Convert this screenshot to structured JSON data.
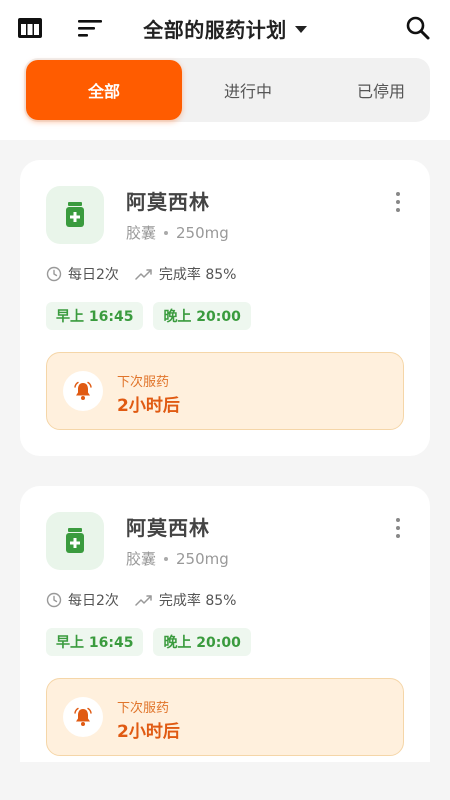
{
  "header": {
    "title": "全部的服药计划",
    "icons": [
      "table-view-icon",
      "sort-icon",
      "search-icon",
      "chevron-down-icon"
    ]
  },
  "tabs": [
    {
      "label": "全部",
      "active": true
    },
    {
      "label": "进行中",
      "active": false
    },
    {
      "label": "已停用",
      "active": false
    }
  ],
  "plans": [
    {
      "name": "阿莫西林",
      "form": "胶囊",
      "dose": "250mg",
      "frequency": "每日2次",
      "completion": "完成率 85%",
      "times": [
        "早上 16:45",
        "晚上 20:00"
      ],
      "next_label": "下次服药",
      "next_value": "2小时后"
    },
    {
      "name": "阿莫西林",
      "form": "胶囊",
      "dose": "250mg",
      "frequency": "每日2次",
      "completion": "完成率 85%",
      "times": [
        "早上 16:45",
        "晚上 20:00"
      ],
      "next_label": "下次服药",
      "next_value": "2小时后"
    }
  ],
  "colors": {
    "accent": "#ff5c00",
    "green": "#3a9b3e",
    "reminder_bg": "#fff0dd",
    "reminder_text": "#e05a12"
  }
}
